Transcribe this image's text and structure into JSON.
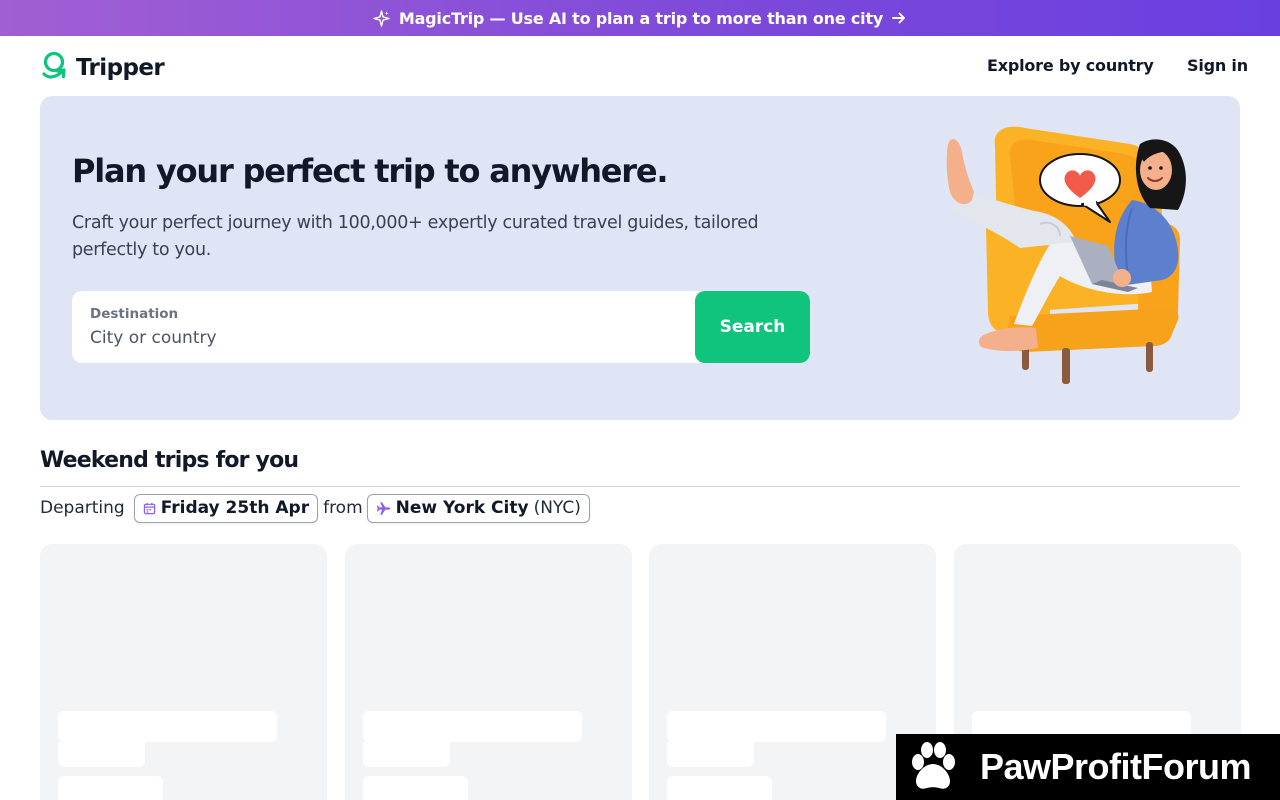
{
  "promo": {
    "text": "MagicTrip — Use AI to plan a trip to more than one city",
    "icon": "sparkle-icon",
    "arrow_icon": "arrow-right-icon"
  },
  "nav": {
    "logo": "Tripper",
    "logo_icon": "tripper-logo-icon",
    "explore": "Explore by country",
    "signin": "Sign in"
  },
  "hero": {
    "title": "Plan your perfect trip to anywhere.",
    "subtitle": "Craft your perfect journey with 100,000+ expertly curated travel guides, tailored perfectly to you.",
    "destination_label": "Destination",
    "destination_placeholder": "City or country",
    "destination_value": "",
    "search_button": "Search",
    "illustration": "woman-in-armchair-illustration"
  },
  "weekend": {
    "title": "Weekend trips for you",
    "departing_label": "Departing",
    "date": "Friday 25th Apr",
    "date_icon": "calendar-icon",
    "from_label": "from",
    "city": "New York City",
    "city_code": "(NYC)",
    "city_icon": "plane-icon",
    "cards": [
      "loading",
      "loading",
      "loading",
      "loading"
    ]
  },
  "watermark": {
    "text": "PawProfitForum",
    "icon": "paw-icon"
  },
  "colors": {
    "promo_gradient_start": "#a25fd3",
    "promo_gradient_end": "#6a3fe0",
    "brand_green": "#10c47e",
    "hero_background": "#e0e5f5",
    "card_skeleton": "#f3f4f6",
    "date_icon_color": "#8b5cf6",
    "plane_icon_color": "#8b5cf6"
  }
}
